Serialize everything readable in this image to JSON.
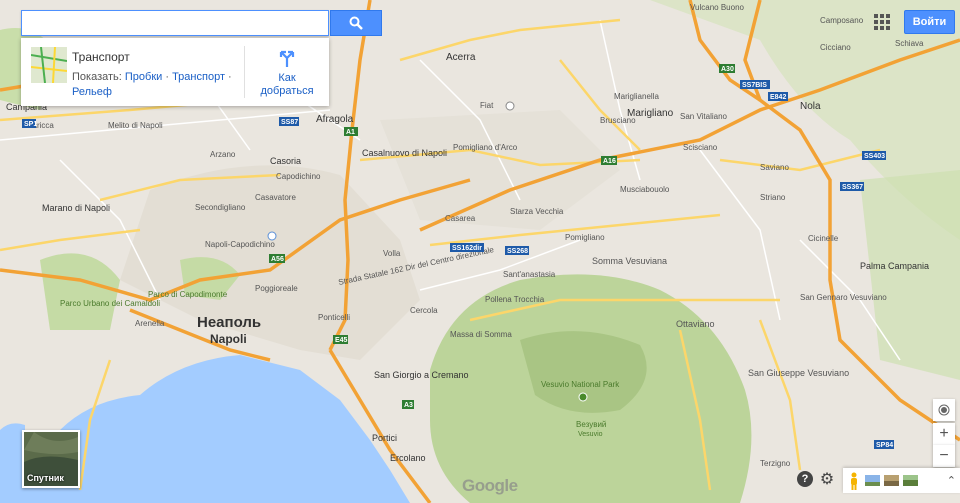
{
  "search": {
    "value": "",
    "placeholder": ""
  },
  "card": {
    "title": "Транспорт",
    "show_label": "Показать:",
    "links": [
      "Пробки",
      "Транспорт",
      "Рельеф"
    ],
    "directions_line1": "Как",
    "directions_line2": "добраться"
  },
  "header": {
    "signin": "Войти"
  },
  "satellite": {
    "label": "Спутник"
  },
  "controls": {
    "zoom_in": "+",
    "zoom_out": "−",
    "help": "?"
  },
  "logo": "Google",
  "colors": {
    "land": "#eae6df",
    "green": "#c5dba5",
    "water": "#a3ccff",
    "highway": "#f2a235",
    "road": "#fcd66a",
    "accent": "#4d90fe"
  },
  "map": {
    "places": [
      {
        "name": "Vulcano Buono"
      },
      {
        "name": "Camposano"
      },
      {
        "name": "Cicciano"
      },
      {
        "name": "Schiava"
      },
      {
        "name": "Acerra"
      },
      {
        "name": "Fiat"
      },
      {
        "name": "Marigliano"
      },
      {
        "name": "Nola"
      },
      {
        "name": "Afragola"
      },
      {
        "name": "Casalnuovo di Napoli"
      },
      {
        "name": "Pomigliano d'Arco"
      },
      {
        "name": "Brusciano"
      },
      {
        "name": "Casoria"
      },
      {
        "name": "Arzano"
      },
      {
        "name": "Melito di Napoli"
      },
      {
        "name": "Marano di Napoli"
      },
      {
        "name": "Villaricca"
      },
      {
        "name": "Campania"
      },
      {
        "name": "Secondigliano"
      },
      {
        "name": "Casavatore"
      },
      {
        "name": "Napoli-Capodichino"
      },
      {
        "name": "Volla"
      },
      {
        "name": "Cercola"
      },
      {
        "name": "Pollena Trocchia"
      },
      {
        "name": "Somma Vesuviana"
      },
      {
        "name": "Sant'anastasia"
      },
      {
        "name": "Ottaviano"
      },
      {
        "name": "San Giuseppe Vesuviano"
      },
      {
        "name": "Palma Campania"
      },
      {
        "name": "Неаполь"
      },
      {
        "name": "Napoli"
      },
      {
        "name": "Parco di Capodimonte"
      },
      {
        "name": "Parco Urbano dei Camaldoli"
      },
      {
        "name": "Arenella"
      },
      {
        "name": "San Giorgio a Cremano"
      },
      {
        "name": "Portici"
      },
      {
        "name": "Ercolano"
      },
      {
        "name": "Vesuvio National Park"
      },
      {
        "name": "Везувий"
      },
      {
        "name": "Vesuvio"
      },
      {
        "name": "Saviano"
      },
      {
        "name": "Scisciano"
      },
      {
        "name": "San Vitaliano"
      },
      {
        "name": "Mariglianella"
      },
      {
        "name": "Starza Vecchia"
      },
      {
        "name": "Casarea"
      },
      {
        "name": "Musciabouolo"
      },
      {
        "name": "Cicinelle"
      },
      {
        "name": "San Gennaro Vesuviano"
      },
      {
        "name": "Poggioreale"
      },
      {
        "name": "Capodichino"
      },
      {
        "name": "Massa di Somma"
      },
      {
        "name": "Striano"
      },
      {
        "name": "Pomigliano"
      },
      {
        "name": "Ponticelli"
      },
      {
        "name": "Terzigno"
      }
    ],
    "road_labels": [
      {
        "name": "A1"
      },
      {
        "name": "A16"
      },
      {
        "name": "A30"
      },
      {
        "name": "A56"
      },
      {
        "name": "A3"
      },
      {
        "name": "E45"
      },
      {
        "name": "SS162dir"
      },
      {
        "name": "SS268"
      },
      {
        "name": "SS7BIS"
      },
      {
        "name": "SP1"
      },
      {
        "name": "SS87"
      },
      {
        "name": "E842"
      },
      {
        "name": "SS403"
      },
      {
        "name": "SS367"
      },
      {
        "name": "SP84"
      },
      {
        "name": "Strada Statale 162 Dir del Centro direzionale"
      }
    ]
  }
}
